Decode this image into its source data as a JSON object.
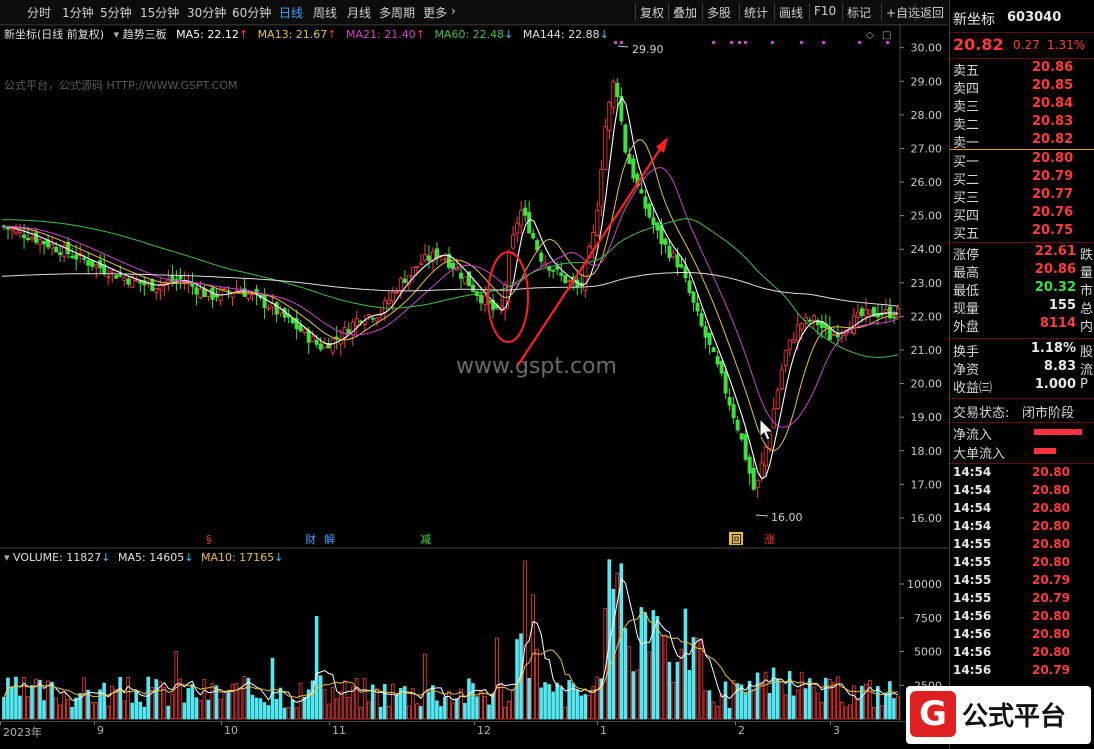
{
  "toolbar": {
    "periods": [
      "分时",
      "1分钟",
      "5分钟",
      "15分钟",
      "30分钟",
      "60分钟",
      "日线",
      "周线",
      "月线",
      "多周期",
      "更多"
    ],
    "active_period": "日线",
    "more_chevron": "›",
    "tools": [
      "复权",
      "叠加",
      "多股",
      "统计",
      "画线",
      "F10",
      "标记",
      "+自选",
      "返回"
    ]
  },
  "chart": {
    "title": "新坐标(日线 前复权)",
    "indicator": "趋势三板",
    "ma5": "MA5: 22.12",
    "ma13": "MA13: 21.67",
    "ma21": "MA21: 21.40",
    "ma60": "MA60: 22.48",
    "ma144": "MA144: 22.88",
    "watermark_top": "公式平台，公式源码 HTTP://WWW.GSPT.COM",
    "watermark_mid": "www.gspt.com",
    "high_label": "29.90",
    "low_label": "16.00",
    "event_markers": [
      "§",
      "财",
      "解",
      "减",
      "回",
      "涨"
    ],
    "colors": {
      "up": "#ff3a3a",
      "down": "#3ce13c",
      "ma5": "#ffffff",
      "ma13": "#e8c040",
      "ma21": "#d040d0",
      "ma60": "#40c040",
      "ma144": "#e0e0e0"
    }
  },
  "chart_data": {
    "type": "candlestick",
    "ylim": [
      15.7,
      30.2
    ],
    "yticks": [
      "30.00",
      "29.00",
      "28.00",
      "27.00",
      "26.00",
      "25.00",
      "24.00",
      "23.00",
      "22.00",
      "21.00",
      "20.00",
      "19.00",
      "18.00",
      "17.00",
      "16.00"
    ],
    "volume": {
      "label": "VOLUME: 11827",
      "ma5": "MA5: 14605",
      "ma10": "MA10: 17165",
      "yticks": [
        "10000",
        "7500",
        "5000",
        "2500"
      ],
      "ylim": [
        0,
        12000
      ]
    },
    "xlabels": [
      "2023年",
      "9",
      "10",
      "11",
      "12",
      "1",
      "2",
      "3"
    ]
  },
  "panel": {
    "name": "新坐标",
    "code": "603040",
    "price": "20.82",
    "change": "0.27",
    "change_pct": "1.31%",
    "asks": [
      [
        "卖五",
        "20.86"
      ],
      [
        "卖四",
        "20.85"
      ],
      [
        "卖三",
        "20.84"
      ],
      [
        "卖二",
        "20.83"
      ],
      [
        "卖一",
        "20.82"
      ]
    ],
    "bids": [
      [
        "买一",
        "20.80"
      ],
      [
        "买二",
        "20.79"
      ],
      [
        "买三",
        "20.77"
      ],
      [
        "买四",
        "20.76"
      ],
      [
        "买五",
        "20.75"
      ]
    ],
    "stats": [
      [
        "涨停",
        "22.61",
        "跌"
      ],
      [
        "最高",
        "20.86",
        "量"
      ],
      [
        "最低",
        "20.32",
        "市"
      ],
      [
        "现量",
        "155",
        "总"
      ],
      [
        "外盘",
        "8114",
        "内"
      ]
    ],
    "stats2": [
      [
        "换手",
        "1.18%",
        "股"
      ],
      [
        "净资",
        "8.83",
        "流"
      ],
      [
        "收益㈢",
        "1.000",
        "P"
      ]
    ],
    "trade_status_label": "交易状态:",
    "trade_status": "闭市阶段",
    "flow": [
      [
        "净流入",
        1.0
      ],
      [
        "大单流入",
        0.45
      ]
    ],
    "ticks": [
      [
        "14:54",
        "20.80"
      ],
      [
        "14:54",
        "20.80"
      ],
      [
        "14:54",
        "20.80"
      ],
      [
        "14:54",
        "20.80"
      ],
      [
        "14:55",
        "20.80"
      ],
      [
        "14:55",
        "20.80"
      ],
      [
        "14:55",
        "20.79"
      ],
      [
        "14:55",
        "20.79"
      ],
      [
        "14:56",
        "20.80"
      ],
      [
        "14:56",
        "20.80"
      ],
      [
        "14:56",
        "20.80"
      ],
      [
        "14:56",
        "20.79"
      ]
    ],
    "logo_text": "公式平台"
  }
}
